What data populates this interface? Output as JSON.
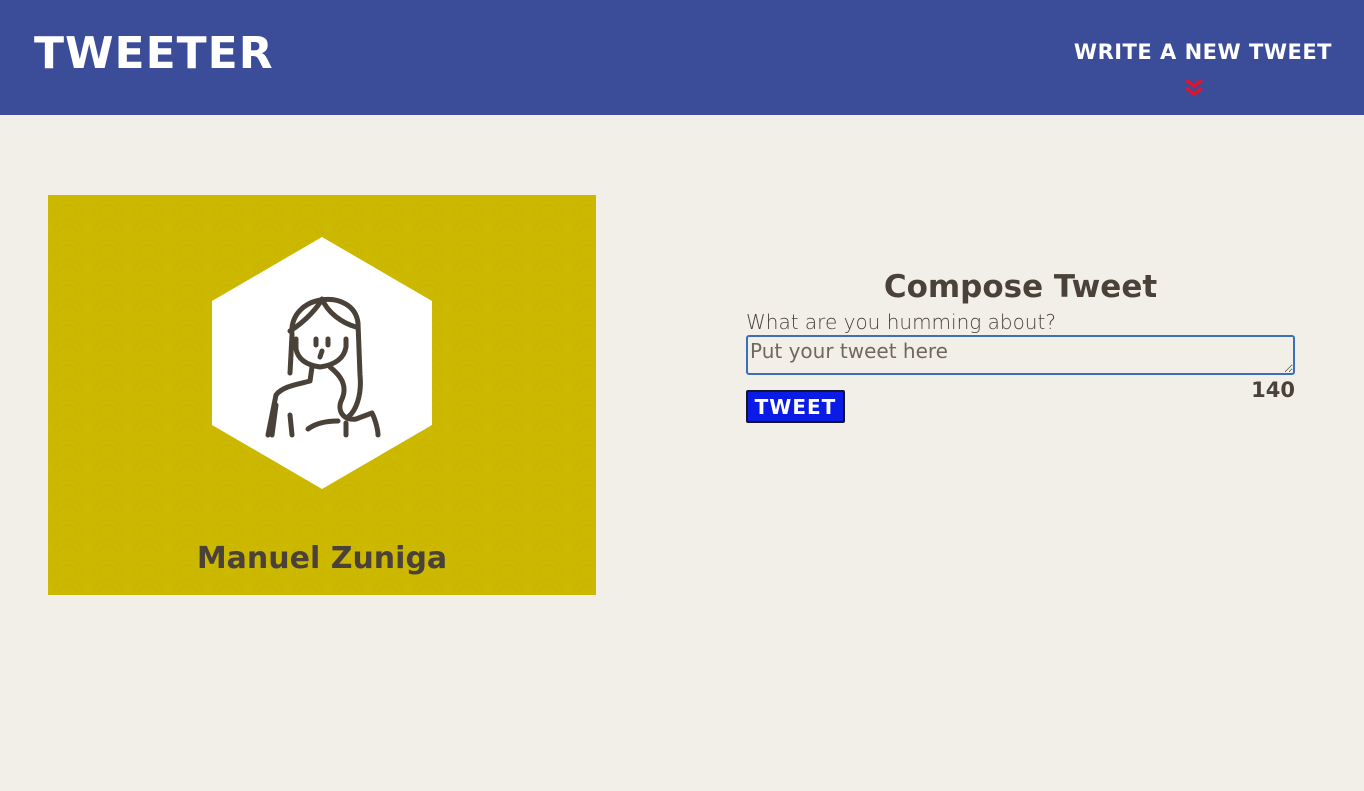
{
  "header": {
    "brand": "TWEETER",
    "write_link": "WRITE A NEW TWEET",
    "write_icon": "double-chevron-down-icon"
  },
  "profile": {
    "name": "Manuel Zuniga",
    "avatar_icon": "person-avatar-icon"
  },
  "compose": {
    "title": "Compose Tweet",
    "label": "What are you humming about?",
    "placeholder": "Put your tweet here",
    "button_label": "TWEET",
    "counter": "140"
  },
  "colors": {
    "navbar": "#3b4c98",
    "page_background": "#f2efe9",
    "profile_background": "#cdb800",
    "tweet_button": "#0a1be6",
    "chevron": "#e0142e",
    "text": "#4a4238"
  }
}
